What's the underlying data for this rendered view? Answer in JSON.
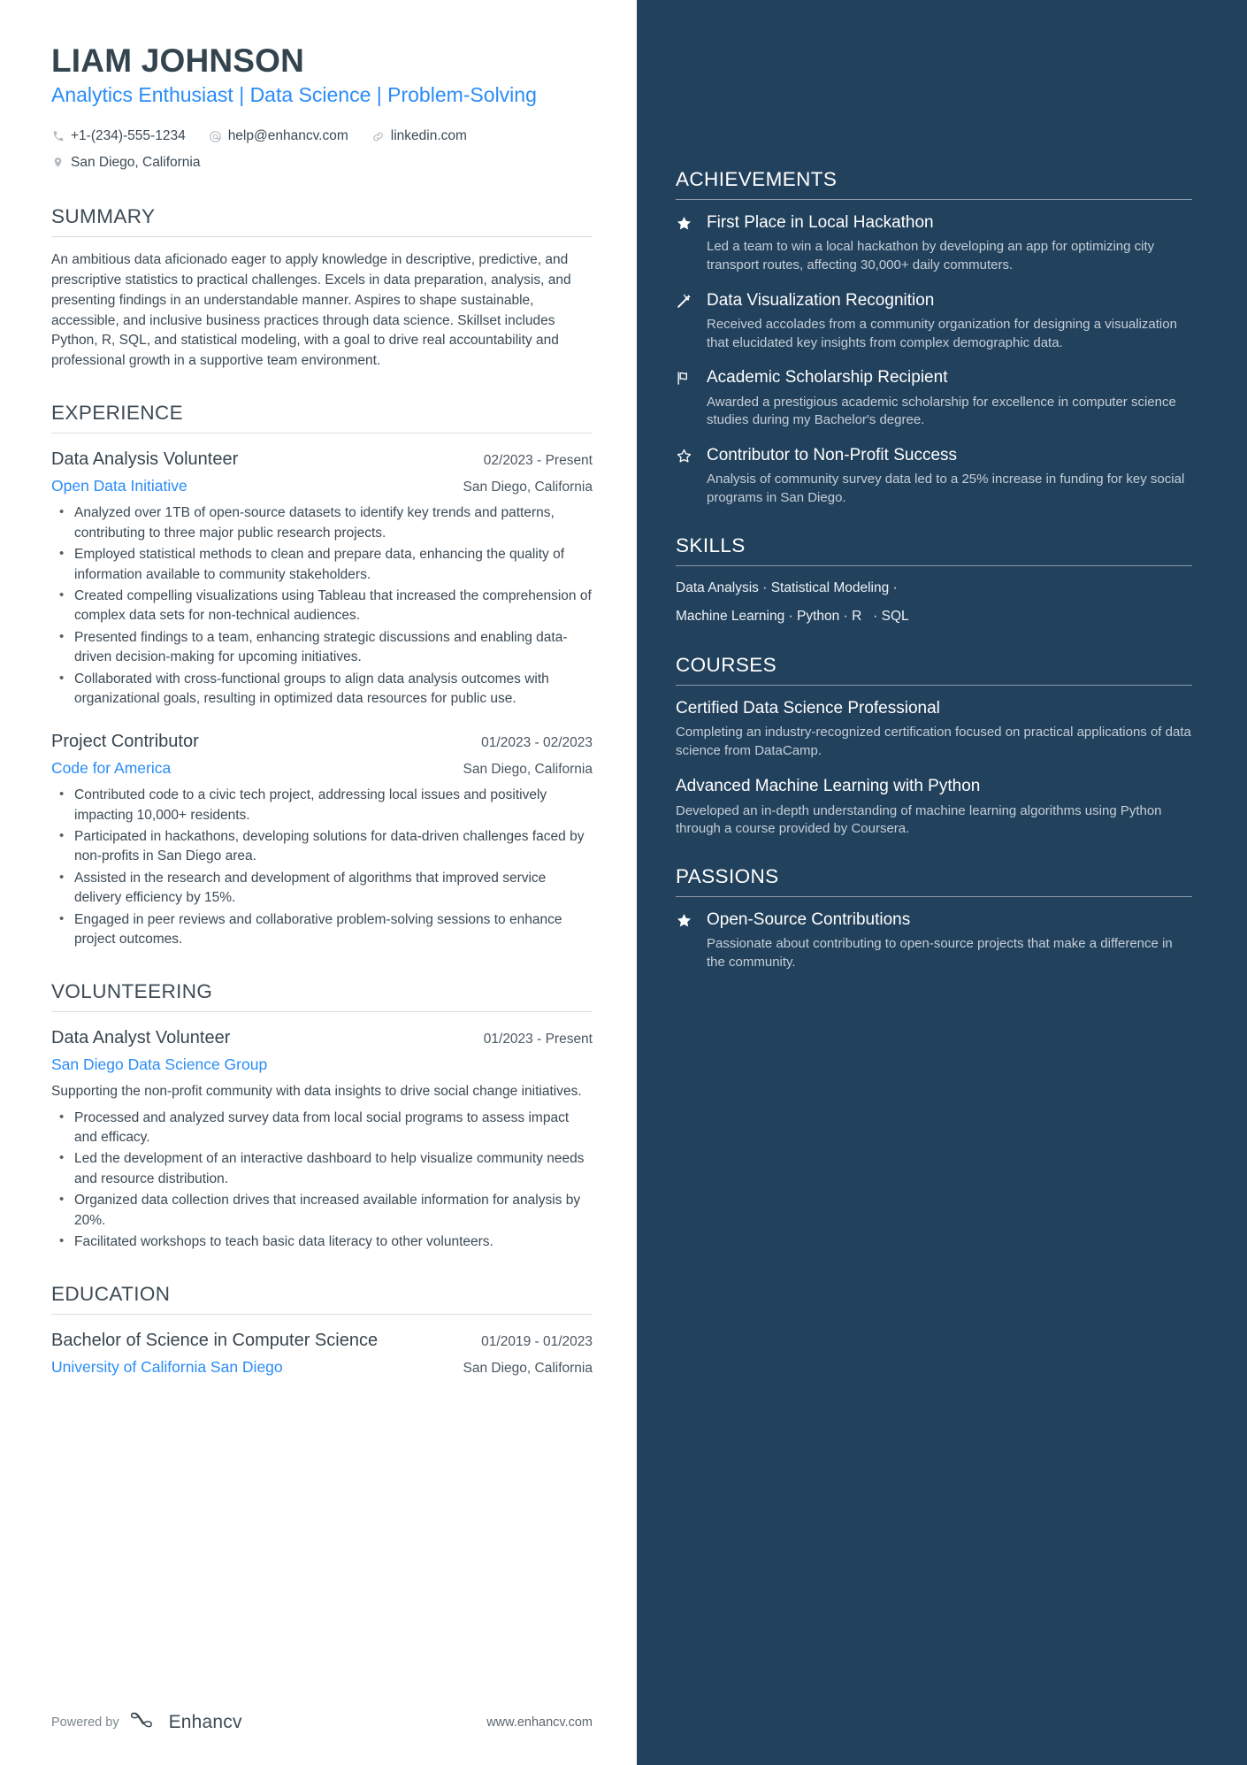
{
  "header": {
    "name": "LIAM JOHNSON",
    "headline": "Analytics Enthusiast | Data Science | Problem-Solving",
    "contacts": [
      {
        "icon": "phone-icon",
        "text": "+1-(234)-555-1234"
      },
      {
        "icon": "email-icon",
        "text": "help@enhancv.com"
      },
      {
        "icon": "link-icon",
        "text": "linkedin.com"
      },
      {
        "icon": "location-icon",
        "text": "San Diego, California"
      }
    ]
  },
  "summary": {
    "title": "SUMMARY",
    "text": "An ambitious data aficionado eager to apply knowledge in descriptive, predictive, and prescriptive statistics to practical challenges. Excels in data preparation, analysis, and presenting findings in an understandable manner. Aspires to shape sustainable, accessible, and inclusive business practices through data science. Skillset includes Python, R, SQL, and statistical modeling, with a goal to drive real accountability and professional growth in a supportive team environment."
  },
  "experience": {
    "title": "EXPERIENCE",
    "entries": [
      {
        "role": "Data Analysis Volunteer",
        "date": "02/2023 - Present",
        "org": "Open Data Initiative",
        "location": "San Diego, California",
        "bullets": [
          "Analyzed over 1TB of open-source datasets to identify key trends and patterns, contributing to three major public research projects.",
          "Employed statistical methods to clean and prepare data, enhancing the quality of information available to community stakeholders.",
          "Created compelling visualizations using Tableau that increased the comprehension of complex data sets for non-technical audiences.",
          "Presented findings to a team, enhancing strategic discussions and enabling data-driven decision-making for upcoming initiatives.",
          "Collaborated with cross-functional groups to align data analysis outcomes with organizational goals, resulting in optimized data resources for public use."
        ]
      },
      {
        "role": "Project Contributor",
        "date": "01/2023 - 02/2023",
        "org": "Code for America",
        "location": "San Diego, California",
        "bullets": [
          "Contributed code to a civic tech project, addressing local issues and positively impacting 10,000+ residents.",
          "Participated in hackathons, developing solutions for data-driven challenges faced by non-profits in San Diego area.",
          "Assisted in the research and development of algorithms that improved service delivery efficiency by 15%.",
          "Engaged in peer reviews and collaborative problem-solving sessions to enhance project outcomes."
        ]
      }
    ]
  },
  "volunteering": {
    "title": "VOLUNTEERING",
    "entries": [
      {
        "role": "Data Analyst Volunteer",
        "date": "01/2023 - Present",
        "org": "San Diego Data Science Group",
        "location": "",
        "description": "Supporting the non-profit community with data insights to drive social change initiatives.",
        "bullets": [
          "Processed and analyzed survey data from local social programs to assess impact and efficacy.",
          "Led the development of an interactive dashboard to help visualize community needs and resource distribution.",
          "Organized data collection drives that increased available information for analysis by 20%.",
          "Facilitated workshops to teach basic data literacy to other volunteers."
        ]
      }
    ]
  },
  "education": {
    "title": "EDUCATION",
    "entries": [
      {
        "degree": "Bachelor of Science in Computer Science",
        "date": "01/2019 - 01/2023",
        "school": "University of California San Diego",
        "location": "San Diego, California"
      }
    ]
  },
  "achievements": {
    "title": "ACHIEVEMENTS",
    "items": [
      {
        "icon": "star-filled-icon",
        "title": "First Place in Local Hackathon",
        "description": "Led a team to win a local hackathon by developing an app for optimizing city transport routes, affecting 30,000+ daily commuters."
      },
      {
        "icon": "magic-wand-icon",
        "title": "Data Visualization Recognition",
        "description": "Received accolades from a community organization for designing a visualization that elucidated key insights from complex demographic data."
      },
      {
        "icon": "flag-icon",
        "title": "Academic Scholarship Recipient",
        "description": "Awarded a prestigious academic scholarship for excellence in computer science studies during my Bachelor's degree."
      },
      {
        "icon": "star-outline-icon",
        "title": "Contributor to Non-Profit Success",
        "description": "Analysis of community survey data led to a 25% increase in funding for key social programs in San Diego."
      }
    ]
  },
  "skills": {
    "title": "SKILLS",
    "line1": [
      "Data Analysis",
      "Statistical Modeling"
    ],
    "line2": [
      "Machine Learning",
      "Python",
      "R",
      "SQL"
    ]
  },
  "courses": {
    "title": "COURSES",
    "items": [
      {
        "title": "Certified Data Science Professional",
        "description": "Completing an industry-recognized certification focused on practical applications of data science from DataCamp."
      },
      {
        "title": "Advanced Machine Learning with Python",
        "description": "Developed an in-depth understanding of machine learning algorithms using Python through a course provided by Coursera."
      }
    ]
  },
  "passions": {
    "title": "PASSIONS",
    "items": [
      {
        "icon": "star-filled-icon",
        "title": "Open-Source Contributions",
        "description": "Passionate about contributing to open-source projects that make a difference in the community."
      }
    ]
  },
  "footer": {
    "powered_by": "Powered by",
    "brand": "Enhancv",
    "site": "www.enhancv.com"
  },
  "colors": {
    "sidebar_bg": "#22415c",
    "accent_link": "#2a8cf7",
    "heading": "#3d4b55"
  }
}
